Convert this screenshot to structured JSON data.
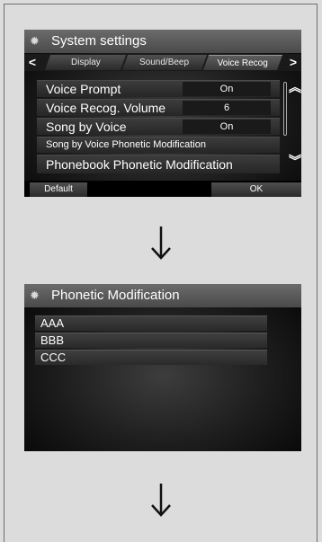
{
  "screen1": {
    "title": "System settings",
    "tabs": [
      {
        "label": "Display",
        "active": false
      },
      {
        "label": "Sound/Beep",
        "active": false
      },
      {
        "label": "Voice Recog",
        "active": true
      }
    ],
    "rows": [
      {
        "label": "Voice Prompt",
        "value": "On"
      },
      {
        "label": "Voice Recog. Volume",
        "value": "6"
      },
      {
        "label": "Song by Voice",
        "value": "On"
      },
      {
        "label": "Song by Voice Phonetic Modification"
      },
      {
        "label": "Phonebook Phonetic Modification"
      }
    ],
    "buttons": {
      "default": "Default",
      "ok": "OK"
    },
    "icons": {
      "left": "chevron-left-icon",
      "right": "chevron-right-icon",
      "up": "double-chevron-up-icon",
      "down": "double-chevron-down-icon",
      "gear": "gear-icon"
    }
  },
  "screen2": {
    "title": "Phonetic Modification",
    "items": [
      "AAA",
      "BBB",
      "CCC"
    ]
  },
  "flow_arrows": [
    "down-arrow-icon",
    "down-arrow-icon"
  ],
  "colors": {
    "page_bg": "#dcdcdc",
    "screen_bg": "#1c1c1c",
    "title_bg": "#5a5a5a"
  }
}
